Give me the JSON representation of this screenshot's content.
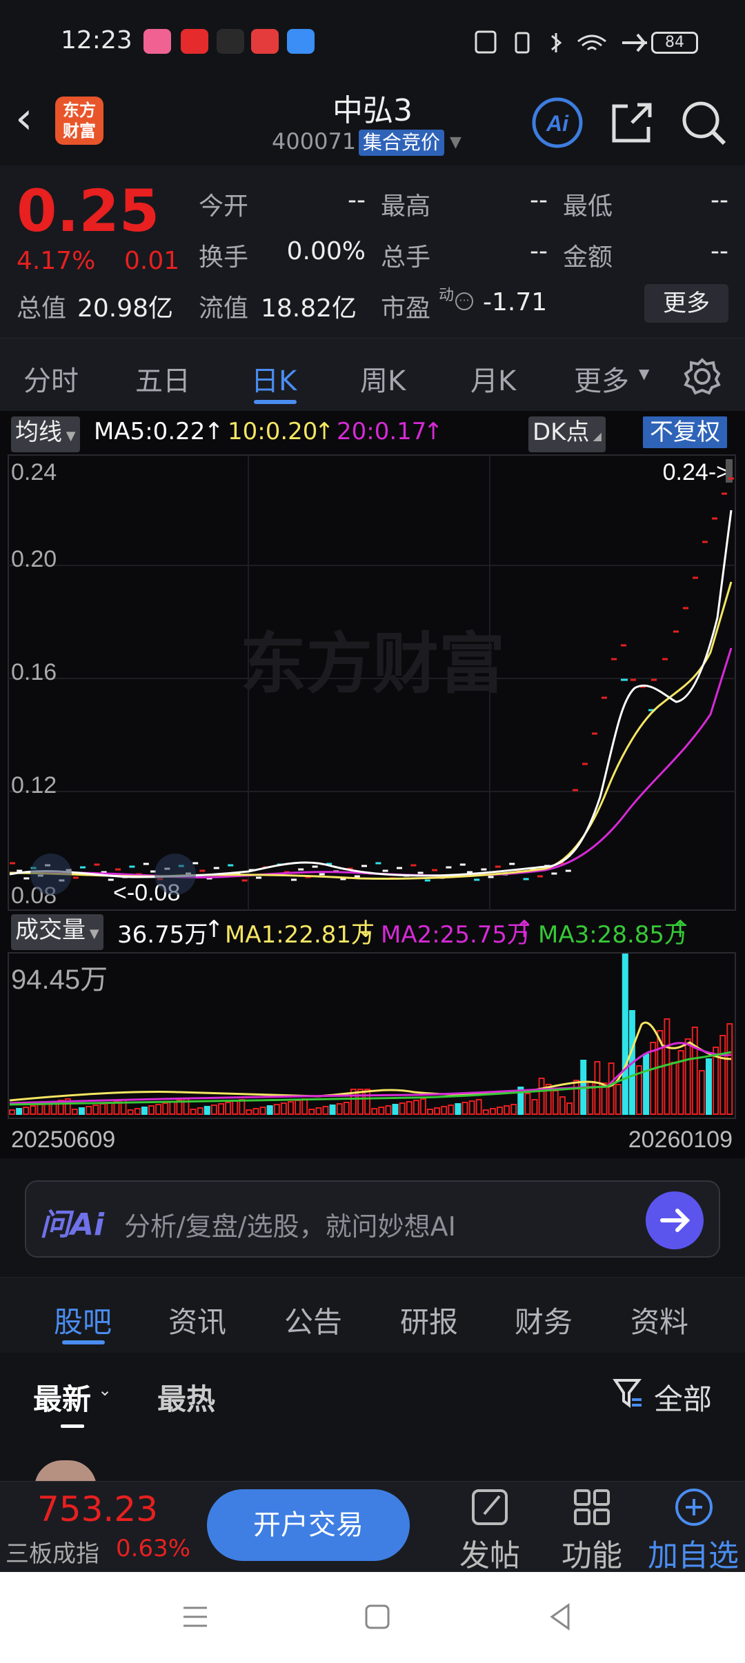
{
  "status": {
    "time": "12:23",
    "battery": "84"
  },
  "header": {
    "logo": "东方财富",
    "stock_name": "中弘3",
    "stock_code": "400071",
    "trade_mode": "集合竞价"
  },
  "quote": {
    "price": "0.25",
    "change_pct": "4.17%",
    "change": "0.01",
    "fields": [
      {
        "label": "今开",
        "value": "--"
      },
      {
        "label": "最高",
        "value": "--"
      },
      {
        "label": "最低",
        "value": "--"
      },
      {
        "label": "换手",
        "value": "0.00%"
      },
      {
        "label": "总手",
        "value": "--"
      },
      {
        "label": "金额",
        "value": "--"
      }
    ],
    "total_value_label": "总值",
    "total_value": "20.98亿",
    "float_value_label": "流值",
    "float_value": "18.82亿",
    "pe_label": "市盈",
    "pe_sup": "动",
    "pe_value": "-1.71",
    "more": "更多"
  },
  "ktabs": [
    "分时",
    "五日",
    "日K",
    "周K",
    "月K",
    "更多"
  ],
  "chart": {
    "ma_btn": "均线",
    "ma5": "MA5:0.22",
    "ma10": "10:0.20",
    "ma20": "20:0.17",
    "dk": "DK点",
    "fq": "不复权",
    "price_axis": [
      "0.24",
      "0.20",
      "0.16",
      "0.12",
      "0.08"
    ],
    "price_pointer": "0.24->",
    "low_marker": "<-0.08",
    "watermark": "东方财富",
    "vol_btn": "成交量",
    "vol": "36.75万",
    "vma1": "MA1:22.81万",
    "vma2": "MA2:25.75万",
    "vma3": "MA3:28.85万",
    "vol_max": "94.45万",
    "date_start": "20250609",
    "date_end": "20260109",
    "colors": {
      "ma5": "#ffffff",
      "ma10": "#f5e663",
      "ma20": "#d62ad6",
      "vma3": "#37c837",
      "up": "#e82020",
      "down": "#2fe3e8"
    }
  },
  "chart_data": {
    "type": "line",
    "x_range": [
      "20250609",
      "20260109"
    ],
    "price_ylim": [
      0.08,
      0.24
    ],
    "series": [
      {
        "name": "MA5",
        "last": 0.22
      },
      {
        "name": "10",
        "last": 0.2
      },
      {
        "name": "20",
        "last": 0.17
      }
    ],
    "volume_max": "94.45万"
  },
  "ai": {
    "logo": "问Ai",
    "placeholder": "分析/复盘/选股，就问妙想AI"
  },
  "btabs": [
    "股吧",
    "资讯",
    "公告",
    "研报",
    "财务",
    "资料"
  ],
  "subtabs": {
    "latest": "最新",
    "hot": "最热",
    "filter": "全部"
  },
  "bottom": {
    "index_value": "753.23",
    "index_name": "三板成指",
    "index_pct": "0.63%",
    "trade": "开户交易",
    "post": "发帖",
    "func": "功能",
    "add": "加自选"
  }
}
